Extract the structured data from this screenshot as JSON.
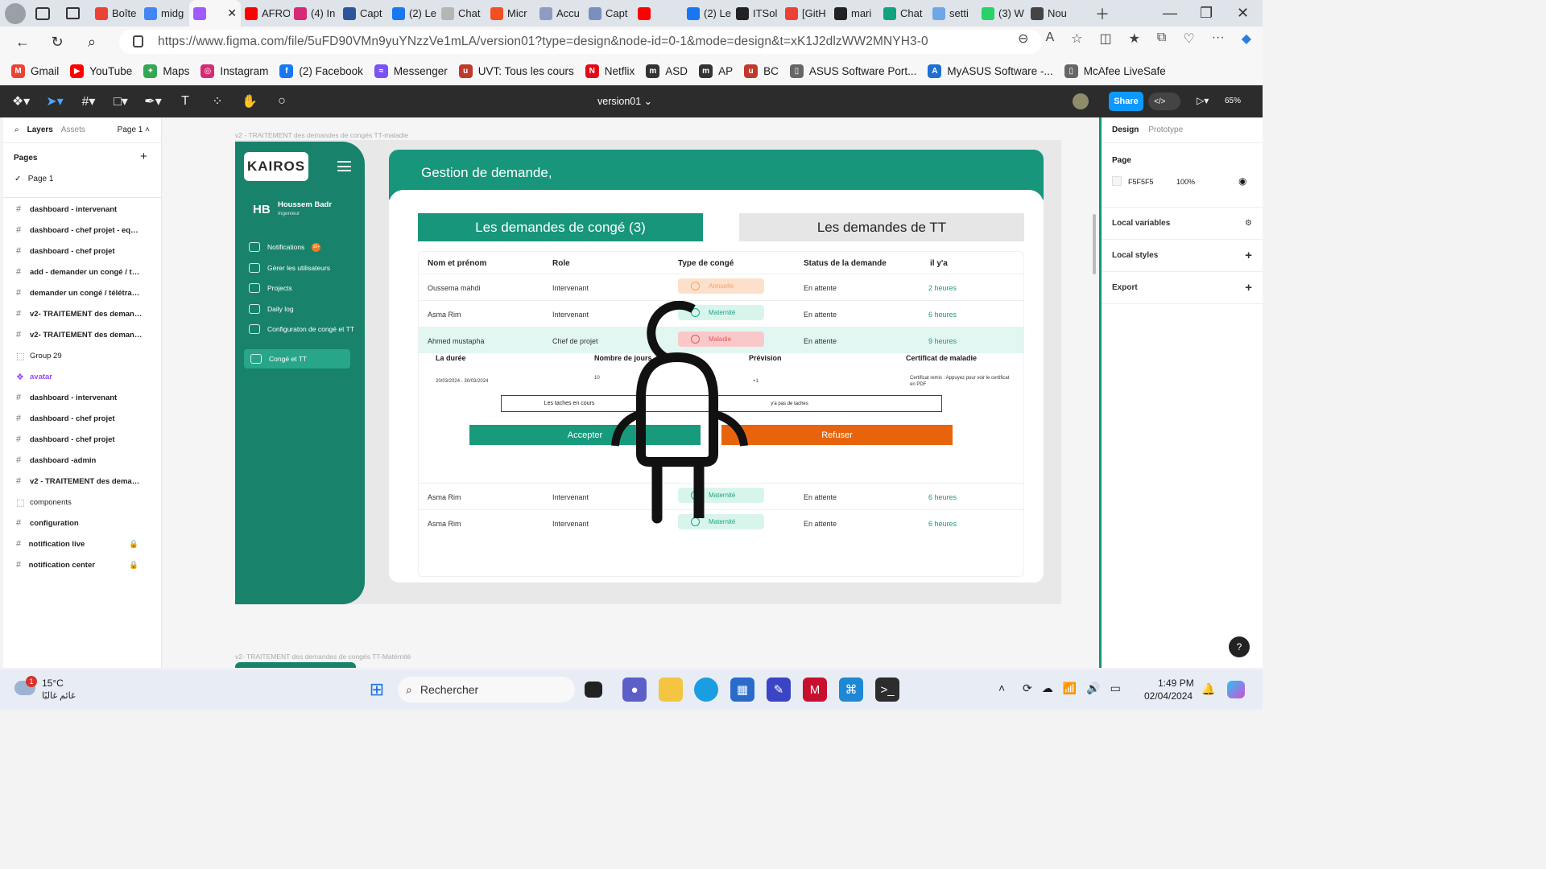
{
  "browser": {
    "tabs": [
      {
        "label": "Boîte",
        "icon": "gmail-icon",
        "color": "#ea4335"
      },
      {
        "label": "midg",
        "icon": "docs-icon",
        "color": "#4285f4"
      },
      {
        "label": "",
        "icon": "figma-icon",
        "color": "#a259ff",
        "active": true
      },
      {
        "label": "AFRO",
        "icon": "youtube-icon",
        "color": "#ff0000"
      },
      {
        "label": "(4) In",
        "icon": "instagram-icon",
        "color": "#d62976"
      },
      {
        "label": "Capt",
        "icon": "word-icon",
        "color": "#2b579a"
      },
      {
        "label": "(2) Le",
        "icon": "facebook-icon",
        "color": "#1877f2"
      },
      {
        "label": "Chat",
        "icon": "chatgpt-icon",
        "color": "#b5b5b5"
      },
      {
        "label": "Micr",
        "icon": "microsoft-icon",
        "color": "#f25022"
      },
      {
        "label": "Accu",
        "icon": "accu-icon",
        "color": "#8e9cc2"
      },
      {
        "label": "Capt",
        "icon": "capture-icon",
        "color": "#7a8fbf"
      },
      {
        "label": "",
        "icon": "youtube-audio-icon",
        "color": "#ff0000"
      },
      {
        "label": "(2) Le",
        "icon": "facebook-icon",
        "color": "#1877f2"
      },
      {
        "label": "ITSol",
        "icon": "github-icon",
        "color": "#222222"
      },
      {
        "label": "[GitH",
        "icon": "gmail-icon",
        "color": "#ea4335"
      },
      {
        "label": "mari",
        "icon": "github-icon",
        "color": "#222222"
      },
      {
        "label": "Chat",
        "icon": "chatgpt-icon",
        "color": "#10a37f"
      },
      {
        "label": "setti",
        "icon": "search-icon",
        "color": "#6ea7e8"
      },
      {
        "label": "(3) W",
        "icon": "whatsapp-icon",
        "color": "#25d366"
      },
      {
        "label": "Nou",
        "icon": "newtab-icon",
        "color": "#444444"
      }
    ],
    "url": "https://www.figma.com/file/5uFD90VMn9yuYNzzVe1mLA/version01?type=design&node-id=0-1&mode=design&t=xK1J2dlzWW2MNYH3-0",
    "bookmarks": [
      {
        "label": "Gmail",
        "icon": "gmail-icon",
        "color": "#ea4335",
        "glyph": "M"
      },
      {
        "label": "YouTube",
        "icon": "youtube-icon",
        "color": "#ff0000",
        "glyph": "▶"
      },
      {
        "label": "Maps",
        "icon": "maps-icon",
        "color": "#34a853",
        "glyph": "✦"
      },
      {
        "label": "Instagram",
        "icon": "instagram-icon",
        "color": "#d62976",
        "glyph": "◎"
      },
      {
        "label": "(2) Facebook",
        "icon": "facebook-icon",
        "color": "#1877f2",
        "glyph": "f"
      },
      {
        "label": "Messenger",
        "icon": "messenger-icon",
        "color": "#7b52f5",
        "glyph": "≈"
      },
      {
        "label": "UVT: Tous les cours",
        "icon": "uvt-icon",
        "color": "#c0392b",
        "glyph": "u"
      },
      {
        "label": "Netflix",
        "icon": "netflix-icon",
        "color": "#e50914",
        "glyph": "N"
      },
      {
        "label": "ASD",
        "icon": "m-icon",
        "color": "#333333",
        "glyph": "m"
      },
      {
        "label": "AP",
        "icon": "m-icon",
        "color": "#333333",
        "glyph": "m"
      },
      {
        "label": "BC",
        "icon": "uvt-icon",
        "color": "#c0392b",
        "glyph": "u"
      },
      {
        "label": "ASUS Software Port...",
        "icon": "page-icon",
        "color": "#666666",
        "glyph": "▯"
      },
      {
        "label": "MyASUS Software -...",
        "icon": "asus-icon",
        "color": "#1f6fd1",
        "glyph": "A"
      },
      {
        "label": "McAfee LiveSafe",
        "icon": "page-icon",
        "color": "#666666",
        "glyph": "▯"
      }
    ]
  },
  "figma": {
    "file_name": "version01",
    "share_label": "Share",
    "zoom": "65%",
    "left": {
      "tab_layers": "Layers",
      "tab_assets": "Assets",
      "page_selector": "Page 1",
      "pages_title": "Pages",
      "current_page": "Page 1",
      "layers": [
        {
          "name": "dashboard - intervenant",
          "icon": "frame-icon"
        },
        {
          "name": "dashboard - chef projet - equipe ...",
          "icon": "frame-icon"
        },
        {
          "name": "dashboard - chef projet",
          "icon": "frame-icon"
        },
        {
          "name": "add - demander un congé / télétr...",
          "icon": "frame-icon"
        },
        {
          "name": "demander un congé / télétravail",
          "icon": "frame-icon"
        },
        {
          "name": "v2- TRAITEMENT des demandes ...",
          "icon": "frame-icon"
        },
        {
          "name": "v2- TRAITEMENT des demandes ...",
          "icon": "frame-icon"
        },
        {
          "name": "Group 29",
          "icon": "group-icon"
        },
        {
          "name": "avatar",
          "icon": "component-icon"
        },
        {
          "name": "dashboard - intervenant",
          "icon": "frame-icon"
        },
        {
          "name": "dashboard - chef projet",
          "icon": "frame-icon"
        },
        {
          "name": "dashboard - chef projet",
          "icon": "frame-icon"
        },
        {
          "name": "dashboard -admin",
          "icon": "frame-icon"
        },
        {
          "name": "v2 - TRAITEMENT des demandes ...",
          "icon": "frame-icon"
        },
        {
          "name": "components",
          "icon": "group-icon"
        },
        {
          "name": "configuration",
          "icon": "frame-icon"
        },
        {
          "name": "notification live",
          "icon": "frame-icon",
          "locked": true
        },
        {
          "name": "notification center",
          "icon": "frame-icon",
          "locked": true
        }
      ]
    },
    "right": {
      "tab_design": "Design",
      "tab_prototype": "Prototype",
      "page_section": "Page",
      "page_color": "F5F5F5",
      "page_opacity": "100%",
      "local_variables": "Local variables",
      "local_styles": "Local styles",
      "export": "Export"
    }
  },
  "canvas": {
    "frame_label_top": "v2 - TRAITEMENT des demandes de congés  TT-maladie",
    "frame_label_bottom": "v2- TRAITEMENT des demandes de congés  TT-Matérnité",
    "app": {
      "logo": "KAIROS",
      "user_initials": "HB",
      "user_name": "Houssem Badr",
      "user_role": "Ingenieur",
      "nav": [
        {
          "label": "Notifications",
          "badge": "10+"
        },
        {
          "label": "Gérer les utilisateurs"
        },
        {
          "label": "Projects"
        },
        {
          "label": "Daily log"
        },
        {
          "label": "Configuraton de congé et TT"
        },
        {
          "label": "Congé et TT",
          "active": true
        }
      ],
      "header_title": "Gestion de demande,",
      "tab_conges": "Les demandes de congé (3)",
      "tab_tt": "Les demandes de TT",
      "columns": [
        "Nom et prénom",
        "Role",
        "Type de congé",
        "Status de la demande",
        "il y'a"
      ],
      "rows": [
        {
          "name": "Oussema mahdi",
          "role": "Intervenant",
          "type": "Annuelle",
          "type_color": "#f6a36a",
          "type_bg": "#fde0cc",
          "status": "En attente",
          "ago": "2 heures"
        },
        {
          "name": "Asma Rim",
          "role": "Intervenant",
          "type": "Maternité",
          "type_color": "#1fa487",
          "type_bg": "#d8f5ec",
          "status": "En attente",
          "ago": "6 heures"
        },
        {
          "name": "Ahmed mustapha",
          "role": "Chef de projet",
          "type": "Maladie",
          "type_color": "#e05a5a",
          "type_bg": "#f9c9c9",
          "status": "En attente",
          "ago": "9 heures"
        },
        {
          "name": "Asma Rim",
          "role": "Intervenant",
          "type": "Maternité",
          "type_color": "#1fa487",
          "type_bg": "#d8f5ec",
          "status": "En attente",
          "ago": "6 heures"
        },
        {
          "name": "Asma Rim",
          "role": "Intervenant",
          "type": "Maternité",
          "type_color": "#1fa487",
          "type_bg": "#d8f5ec",
          "status": "En attente",
          "ago": "6 heures"
        }
      ],
      "detail": {
        "duree_label": "La durée",
        "duree_value": "20/03/2024 - 30/03/2024",
        "jours_label": "Nombre de jours",
        "jours_value": "10",
        "prevision_label": "Prévision",
        "prevision_value": "+1",
        "certif_label": "Certificat de maladie",
        "certif_value": "Certificat remis : Appuyez pour voir le certificat en PDF",
        "taches_label": "Les taches en cours",
        "taches_value": "y'a pas de taches",
        "accept_label": "Accepter",
        "refuse_label": "Refuser"
      }
    }
  },
  "taskbar": {
    "weather_temp": "15°C",
    "weather_desc": "غائم غالبًا",
    "weather_badge": "1",
    "search_placeholder": "Rechercher",
    "time": "1:49 PM",
    "date": "02/04/2024"
  },
  "colors": {
    "brand_green": "#17967b",
    "sidebar_green": "#19826a",
    "refuse_orange": "#e8640c",
    "figma_blue": "#0d99ff"
  }
}
